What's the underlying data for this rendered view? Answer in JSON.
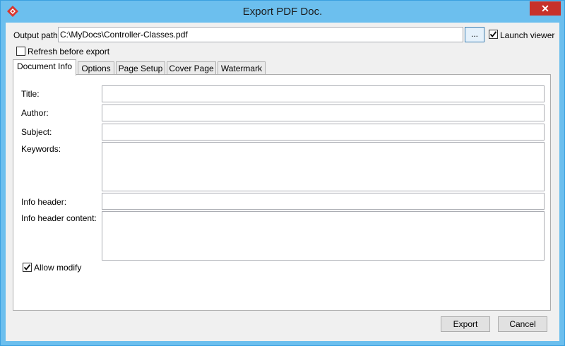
{
  "window": {
    "title": "Export PDF Doc.",
    "close_label": "✕"
  },
  "output_path": {
    "label": "Output path:",
    "value": "C:\\MyDocs\\Controller-Classes.pdf",
    "browse_label": "..."
  },
  "launch_viewer": {
    "label": "Launch viewer",
    "checked": true
  },
  "refresh_before_export": {
    "label": "Refresh before export",
    "checked": false
  },
  "tabs": [
    {
      "label": "Document Info",
      "active": true
    },
    {
      "label": "Options"
    },
    {
      "label": "Page Setup"
    },
    {
      "label": "Cover Page"
    },
    {
      "label": "Watermark"
    }
  ],
  "document_info": {
    "title_label": "Title:",
    "author_label": "Author:",
    "subject_label": "Subject:",
    "keywords_label": "Keywords:",
    "info_header_label": "Info header:",
    "info_header_content_label": "Info header content:",
    "allow_modify_label": "Allow modify",
    "allow_modify_checked": true
  },
  "buttons": {
    "export": "Export",
    "cancel": "Cancel"
  },
  "colors": {
    "titlebar": "#6cbfee",
    "close": "#c7312a",
    "accent": "#3c7fb1"
  }
}
